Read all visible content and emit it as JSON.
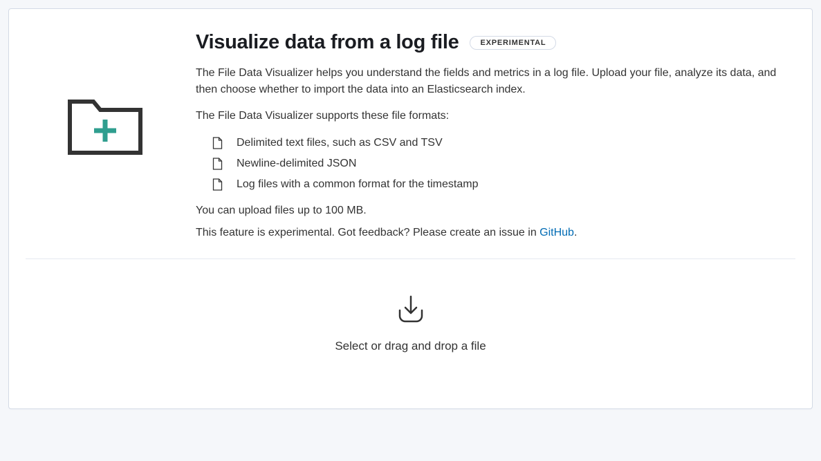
{
  "header": {
    "title": "Visualize data from a log file",
    "badge": "EXPERIMENTAL"
  },
  "description": "The File Data Visualizer helps you understand the fields and metrics in a log file. Upload your file, analyze its data, and then choose whether to import the data into an Elasticsearch index.",
  "formats_intro": "The File Data Visualizer supports these file formats:",
  "formats": [
    "Delimited text files, such as CSV and TSV",
    "Newline-delimited JSON",
    "Log files with a common format for the timestamp"
  ],
  "upload_limit": "You can upload files up to 100 MB.",
  "feedback": {
    "prefix": "This feature is experimental. Got feedback? Please create an issue in ",
    "link_text": "GitHub",
    "suffix": "."
  },
  "dropzone": {
    "text": "Select or drag and drop a file"
  }
}
